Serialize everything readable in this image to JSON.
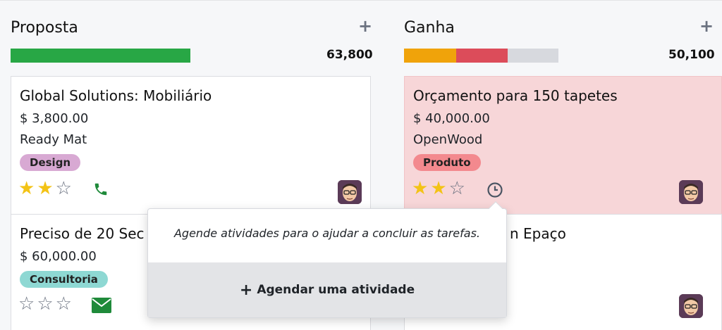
{
  "columns": [
    {
      "title": "Proposta",
      "total": "63,800",
      "progress": [
        {
          "fraction": 1.0,
          "color": "#28a745"
        }
      ],
      "cards": [
        {
          "title": "Global Solutions: Mobiliário",
          "amount": "$ 3,800.00",
          "partner": "Ready Mat",
          "tag": "Design",
          "tag_color": "#d8a9d3",
          "stars": 2,
          "activity_icon": "phone-icon"
        },
        {
          "title": "Preciso de 20 Sec",
          "amount": "$ 60,000.00",
          "tag": "Consultoria",
          "tag_color": "#8ed8d3",
          "stars": 0,
          "activity_icon": "envelope-icon"
        }
      ]
    },
    {
      "title": "Ganha",
      "total": "50,100",
      "progress": [
        {
          "fraction": 0.34,
          "color": "#f0a30a"
        },
        {
          "fraction": 0.33,
          "color": "#dc4c5a"
        }
      ],
      "cards": [
        {
          "title": "Orçamento para 150 tapetes",
          "amount": "$ 40,000.00",
          "partner": "OpenWood",
          "tag": "Produto",
          "tag_color": "#f3898e",
          "stars": 2,
          "activity_icon": "clock-icon"
        },
        {
          "title": "n Epaço"
        }
      ]
    }
  ],
  "popover": {
    "message": "Agende atividades para o ajudar a concluir as tarefas.",
    "button_label": "Agendar uma atividade",
    "button_icon": "plus-icon"
  },
  "add_icon": "plus-icon"
}
